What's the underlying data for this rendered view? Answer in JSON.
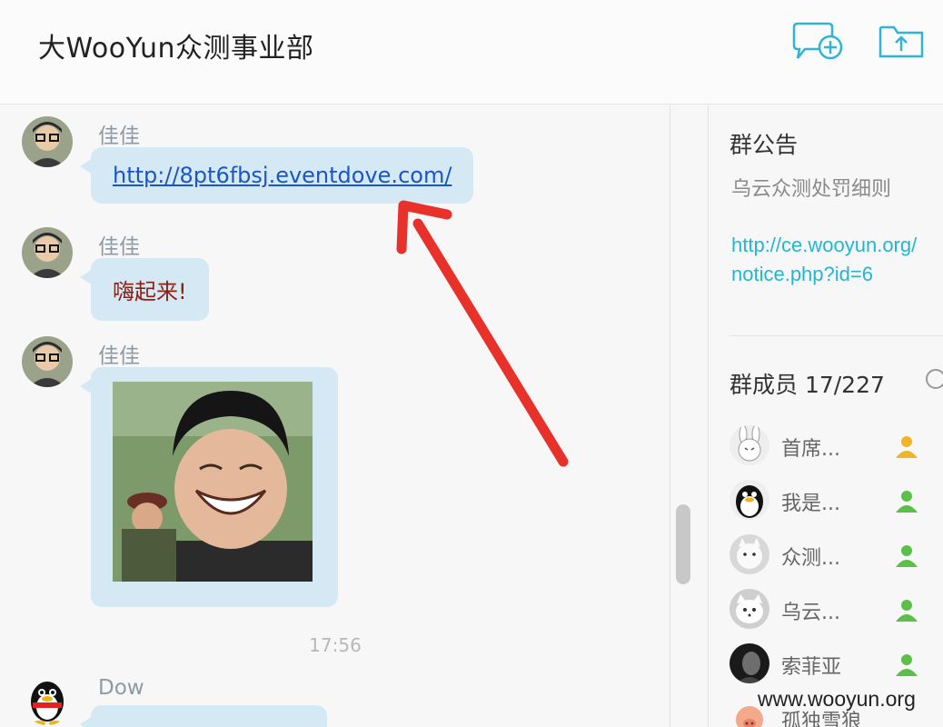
{
  "header": {
    "title": "大WooYun众测事业部"
  },
  "messages": [
    {
      "sender": "佳佳",
      "link": "http://8pt6fbsj.eventdove.com/"
    },
    {
      "sender": "佳佳",
      "text": "嗨起来!"
    },
    {
      "sender": "佳佳",
      "image": "kim-jong-un-laughing-photo"
    },
    {
      "timestamp": "17:56"
    },
    {
      "sender": "Dow"
    }
  ],
  "sidebar": {
    "notice_heading": "群公告",
    "notice_text": "乌云众测处罚细则",
    "notice_link_line1": "http://ce.wooyun.org/",
    "notice_link_line2": "notice.php?id=6",
    "members_heading": "群成员 17/227",
    "members": [
      {
        "name": "首席...",
        "role": "owner"
      },
      {
        "name": "我是...",
        "role": "admin"
      },
      {
        "name": "众测...",
        "role": "admin"
      },
      {
        "name": "乌云...",
        "role": "admin"
      },
      {
        "name": "索菲亚",
        "role": "admin"
      },
      {
        "name": "孤独雪狼",
        "role": ""
      }
    ]
  },
  "watermark": "www.wooyun.org",
  "colors": {
    "bubble": "#d4e9f4",
    "link": "#1a56c8",
    "notice_link": "#22b7d1",
    "arrow": "#e8312a"
  }
}
